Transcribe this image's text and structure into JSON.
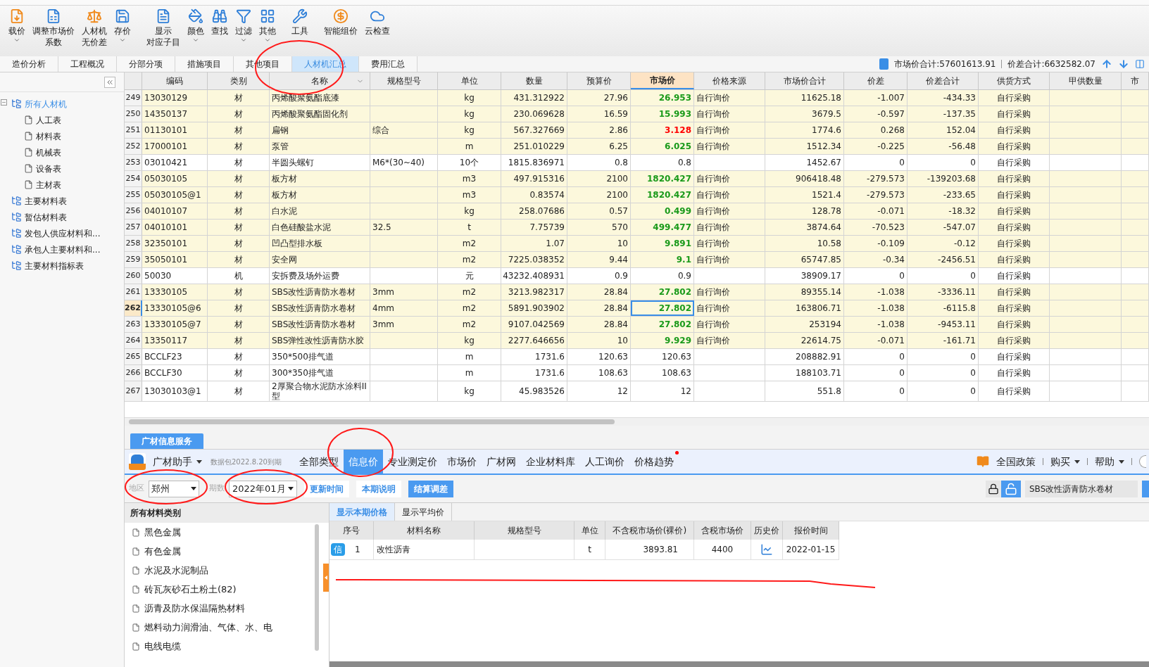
{
  "toolbar": [
    {
      "lines": [
        "载价"
      ],
      "dropdown": true
    },
    {
      "lines": [
        "调整市场价",
        "系数"
      ],
      "dropdown": false
    },
    {
      "lines": [
        "人材机",
        "无价差"
      ],
      "dropdown": false
    },
    {
      "lines": [
        "存价"
      ],
      "dropdown": true
    },
    {
      "lines": [
        "显示",
        "对应子目"
      ],
      "dropdown": false
    },
    {
      "lines": [
        "颜色"
      ],
      "dropdown": true
    },
    {
      "lines": [
        "查找"
      ],
      "dropdown": false
    },
    {
      "lines": [
        "过滤"
      ],
      "dropdown": true
    },
    {
      "lines": [
        "其他"
      ],
      "dropdown": true
    },
    {
      "lines": [
        "工具"
      ],
      "dropdown": false
    },
    {
      "lines": [
        "智能组价"
      ],
      "dropdown": false
    },
    {
      "lines": [
        "云检查"
      ],
      "dropdown": false
    }
  ],
  "tabs": [
    {
      "label": "造价分析",
      "selected": false
    },
    {
      "label": "工程概况",
      "selected": false
    },
    {
      "label": "分部分项",
      "selected": false
    },
    {
      "label": "措施项目",
      "selected": false
    },
    {
      "label": "其他项目",
      "selected": false
    },
    {
      "label": "人材机汇总",
      "selected": true
    },
    {
      "label": "费用汇总",
      "selected": false
    }
  ],
  "totals": [
    {
      "label": "市场价合计:57601613.91"
    },
    {
      "label": "价差合计:6632582.07"
    }
  ],
  "sidebar": {
    "items": [
      {
        "label": "所有人材机",
        "selected": true,
        "children": [
          {
            "label": "人工表",
            "selected": false
          },
          {
            "label": "材料表",
            "selected": false
          },
          {
            "label": "机械表",
            "selected": false
          },
          {
            "label": "设备表",
            "selected": false
          },
          {
            "label": "主材表",
            "selected": false
          }
        ]
      },
      {
        "label": "主要材料表",
        "selected": false
      },
      {
        "label": "暂估材料表",
        "selected": false
      },
      {
        "label": "发包人供应材料和...",
        "selected": false
      },
      {
        "label": "承包人主要材料和...",
        "selected": false
      },
      {
        "label": "主要材料指标表",
        "selected": false
      }
    ]
  },
  "table": {
    "columns": [
      {
        "label": "编码",
        "highlighted": false,
        "dropdown": false
      },
      {
        "label": "类别",
        "highlighted": false,
        "dropdown": false
      },
      {
        "label": "名称",
        "highlighted": false,
        "dropdown": true
      },
      {
        "label": "规格型号",
        "highlighted": false,
        "dropdown": false
      },
      {
        "label": "单位",
        "highlighted": false,
        "dropdown": false
      },
      {
        "label": "数量",
        "highlighted": false,
        "dropdown": false
      },
      {
        "label": "预算价",
        "highlighted": false,
        "dropdown": false
      },
      {
        "label": "市场价",
        "highlighted": true,
        "dropdown": false
      },
      {
        "label": "价格来源",
        "highlighted": false,
        "dropdown": false
      },
      {
        "label": "市场价合计",
        "highlighted": false,
        "dropdown": false
      },
      {
        "label": "价差",
        "highlighted": false,
        "dropdown": false
      },
      {
        "label": "价差合计",
        "highlighted": false,
        "dropdown": false
      },
      {
        "label": "供货方式",
        "highlighted": false,
        "dropdown": false
      },
      {
        "label": "甲供数量",
        "highlighted": false,
        "dropdown": false
      },
      {
        "label": "市",
        "highlighted": false,
        "dropdown": false
      }
    ],
    "rows": [
      {
        "no": "249",
        "code": "13030129",
        "type": "材",
        "name": "丙烯酸聚氨酯底漆",
        "unit": "kg",
        "qty": "431.312922",
        "budget": "27.96",
        "market": "26.953",
        "color": "#1a9a1a",
        "source": "自行询价",
        "total": "11625.18",
        "diff": "-1.007",
        "diff_total": "-434.33",
        "supply": "自行采购",
        "highlighted": true,
        "selected": false
      },
      {
        "no": "250",
        "code": "14350137",
        "type": "材",
        "name": "丙烯酸聚氨酯固化剂",
        "unit": "kg",
        "qty": "230.069628",
        "budget": "16.59",
        "market": "15.993",
        "color": "#1a9a1a",
        "source": "自行询价",
        "total": "3679.5",
        "diff": "-0.597",
        "diff_total": "-137.35",
        "supply": "自行采购",
        "highlighted": true,
        "selected": false
      },
      {
        "no": "251",
        "code": "01130101",
        "type": "材",
        "name": "扁钢",
        "spec": "综合",
        "unit": "kg",
        "qty": "567.327669",
        "budget": "2.86",
        "market": "3.128",
        "color": "#ff0000",
        "source": "自行询价",
        "total": "1774.6",
        "diff": "0.268",
        "diff_total": "152.04",
        "supply": "自行采购",
        "highlighted": true,
        "selected": false
      },
      {
        "no": "252",
        "code": "17000101",
        "type": "材",
        "name": "泵管",
        "unit": "m",
        "qty": "251.010229",
        "budget": "6.25",
        "market": "6.025",
        "color": "#1a9a1a",
        "source": "自行询价",
        "total": "1512.34",
        "diff": "-0.225",
        "diff_total": "-56.48",
        "supply": "自行采购",
        "highlighted": true,
        "selected": false
      },
      {
        "no": "253",
        "code": "03010421",
        "type": "材",
        "name": "半圆头螺钉",
        "spec": "M6*(30~40)",
        "unit": "10个",
        "qty": "1815.836971",
        "budget": "0.8",
        "market": "0.8",
        "color": "#222222",
        "total": "1452.67",
        "diff": "0",
        "diff_total": "0",
        "supply": "自行采购",
        "highlighted": false,
        "selected": false
      },
      {
        "no": "254",
        "code": "05030105",
        "type": "材",
        "name": "板方材",
        "unit": "m3",
        "qty": "497.915316",
        "budget": "2100",
        "market": "1820.427",
        "color": "#1a9a1a",
        "source": "自行询价",
        "total": "906418.48",
        "diff": "-279.573",
        "diff_total": "-139203.68",
        "supply": "自行采购",
        "highlighted": true,
        "selected": false
      },
      {
        "no": "255",
        "code": "05030105@1",
        "type": "材",
        "name": "板方材",
        "unit": "m3",
        "qty": "0.83574",
        "budget": "2100",
        "market": "1820.427",
        "color": "#1a9a1a",
        "source": "自行询价",
        "total": "1521.4",
        "diff": "-279.573",
        "diff_total": "-233.65",
        "supply": "自行采购",
        "highlighted": true,
        "selected": false
      },
      {
        "no": "256",
        "code": "04010107",
        "type": "材",
        "name": "白水泥",
        "unit": "kg",
        "qty": "258.07686",
        "budget": "0.57",
        "market": "0.499",
        "color": "#1a9a1a",
        "source": "自行询价",
        "total": "128.78",
        "diff": "-0.071",
        "diff_total": "-18.32",
        "supply": "自行采购",
        "highlighted": true,
        "selected": false
      },
      {
        "no": "257",
        "code": "04010101",
        "type": "材",
        "name": "白色硅酸盐水泥",
        "spec": "32.5",
        "unit": "t",
        "qty": "7.75739",
        "budget": "570",
        "market": "499.477",
        "color": "#1a9a1a",
        "source": "自行询价",
        "total": "3874.64",
        "diff": "-70.523",
        "diff_total": "-547.07",
        "supply": "自行采购",
        "highlighted": true,
        "selected": false
      },
      {
        "no": "258",
        "code": "32350101",
        "type": "材",
        "name": "凹凸型排水板",
        "unit": "m2",
        "qty": "1.07",
        "budget": "10",
        "market": "9.891",
        "color": "#1a9a1a",
        "source": "自行询价",
        "total": "10.58",
        "diff": "-0.109",
        "diff_total": "-0.12",
        "supply": "自行采购",
        "highlighted": true,
        "selected": false
      },
      {
        "no": "259",
        "code": "35050101",
        "type": "材",
        "name": "安全网",
        "unit": "m2",
        "qty": "7225.038352",
        "budget": "9.44",
        "market": "9.1",
        "color": "#1a9a1a",
        "source": "自行询价",
        "total": "65747.85",
        "diff": "-0.34",
        "diff_total": "-2456.51",
        "supply": "自行采购",
        "highlighted": true,
        "selected": false
      },
      {
        "no": "260",
        "code": "50030",
        "type": "机",
        "name": "安拆费及场外运费",
        "unit": "元",
        "qty": "43232.408931",
        "budget": "0.9",
        "market": "0.9",
        "color": "#222222",
        "total": "38909.17",
        "diff": "0",
        "diff_total": "0",
        "supply": "自行采购",
        "highlighted": false,
        "selected": false
      },
      {
        "no": "261",
        "code": "13330105",
        "type": "材",
        "name": "SBS改性沥青防水卷材",
        "spec": "3mm",
        "unit": "m2",
        "qty": "3213.982317",
        "budget": "28.84",
        "market": "27.802",
        "color": "#1a9a1a",
        "source": "自行询价",
        "total": "89355.14",
        "diff": "-1.038",
        "diff_total": "-3336.11",
        "supply": "自行采购",
        "highlighted": true,
        "selected": false
      },
      {
        "no": "262",
        "code": "13330105@6",
        "type": "材",
        "name": "SBS改性沥青防水卷材",
        "spec": "4mm",
        "unit": "m2",
        "qty": "5891.903902",
        "budget": "28.84",
        "market": "27.802",
        "color": "#1a9a1a",
        "source": "自行询价",
        "total": "163806.71",
        "diff": "-1.038",
        "diff_total": "-6115.8",
        "supply": "自行采购",
        "highlighted": true,
        "selected": true
      },
      {
        "no": "263",
        "code": "13330105@7",
        "type": "材",
        "name": "SBS改性沥青防水卷材",
        "spec": "3mm",
        "unit": "m2",
        "qty": "9107.042569",
        "budget": "28.84",
        "market": "27.802",
        "color": "#1a9a1a",
        "source": "自行询价",
        "total": "253194",
        "diff": "-1.038",
        "diff_total": "-9453.11",
        "supply": "自行采购",
        "highlighted": true,
        "selected": false
      },
      {
        "no": "264",
        "code": "13350117",
        "type": "材",
        "name": "SBS弹性改性沥青防水胶",
        "unit": "kg",
        "qty": "2277.646656",
        "budget": "10",
        "market": "9.929",
        "color": "#1a9a1a",
        "source": "自行询价",
        "total": "22614.75",
        "diff": "-0.071",
        "diff_total": "-161.71",
        "supply": "自行采购",
        "highlighted": true,
        "selected": false
      },
      {
        "no": "265",
        "code": "BCCLF23",
        "type": "材",
        "name": "350*500排气道",
        "unit": "m",
        "qty": "1731.6",
        "budget": "120.63",
        "market": "120.63",
        "color": "#222222",
        "total": "208882.91",
        "diff": "0",
        "diff_total": "0",
        "supply": "自行采购",
        "highlighted": false,
        "selected": false
      },
      {
        "no": "266",
        "code": "BCCLF30",
        "type": "材",
        "name": "300*350排气道",
        "unit": "m",
        "qty": "1731.6",
        "budget": "108.63",
        "market": "108.63",
        "color": "#222222",
        "total": "188103.71",
        "diff": "0",
        "diff_total": "0",
        "supply": "自行采购",
        "highlighted": false,
        "selected": false
      },
      {
        "no": "267",
        "code": "13030103@1",
        "type": "材",
        "name": "2厚聚合物水泥防水涂料II型",
        "unit": "kg",
        "qty": "45.983526",
        "budget": "12",
        "market": "12",
        "color": "#222222",
        "total": "551.8",
        "diff": "0",
        "diff_total": "0",
        "supply": "自行采购",
        "highlighted": false,
        "selected": false
      }
    ]
  },
  "info_panel": {
    "tab": "广材信息服务",
    "brand": "广材助手",
    "package_note": "数据包2022.8.20到期",
    "nav": [
      {
        "label": "全部类型",
        "selected": false,
        "dot": false
      },
      {
        "label": "信息价",
        "selected": true,
        "dot": false
      },
      {
        "label": "专业测定价",
        "selected": false,
        "dot": false
      },
      {
        "label": "市场价",
        "selected": false,
        "dot": false
      },
      {
        "label": "广材网",
        "selected": false,
        "dot": false
      },
      {
        "label": "企业材料库",
        "selected": false,
        "dot": false
      },
      {
        "label": "人工询价",
        "selected": false,
        "dot": false
      },
      {
        "label": "价格趋势",
        "selected": false,
        "dot": true
      }
    ],
    "right_menu": [
      {
        "label": "全国政策",
        "dropdown": false
      },
      {
        "label": "购买",
        "dropdown": true
      },
      {
        "label": "帮助",
        "dropdown": true
      }
    ],
    "region": {
      "label": "地区",
      "value": "郑州"
    },
    "period": {
      "label": "期数",
      "value": "2022年01月"
    },
    "buttons": [
      {
        "label": "更新时间",
        "primary": false
      },
      {
        "label": "本期说明",
        "primary": false
      },
      {
        "label": "结算调差",
        "primary": true
      }
    ],
    "search": {
      "value": "SBS改性沥青防水卷材"
    },
    "categories": {
      "title": "所有材料类别",
      "items": [
        "黑色金属",
        "有色金属",
        "水泥及水泥制品",
        "砖瓦灰砂石土粉土(82)",
        "沥青及防水保温隔热材料",
        "燃料动力润滑油、气体、水、电",
        "电线电缆"
      ]
    },
    "subtabs": [
      {
        "label": "显示本期价格",
        "selected": true
      },
      {
        "label": "显示平均价",
        "selected": false
      }
    ],
    "columns": [
      "序号",
      "材料名称",
      "规格型号",
      "单位",
      "不含税市场价(裸价)",
      "含税市场价",
      "历史价",
      "报价时间"
    ],
    "rows": [
      {
        "badge": "信",
        "no": "1",
        "name": "改性沥青",
        "unit": "t",
        "price": "3893.81",
        "tax_price": "4400",
        "date": "2022-01-15"
      }
    ]
  }
}
